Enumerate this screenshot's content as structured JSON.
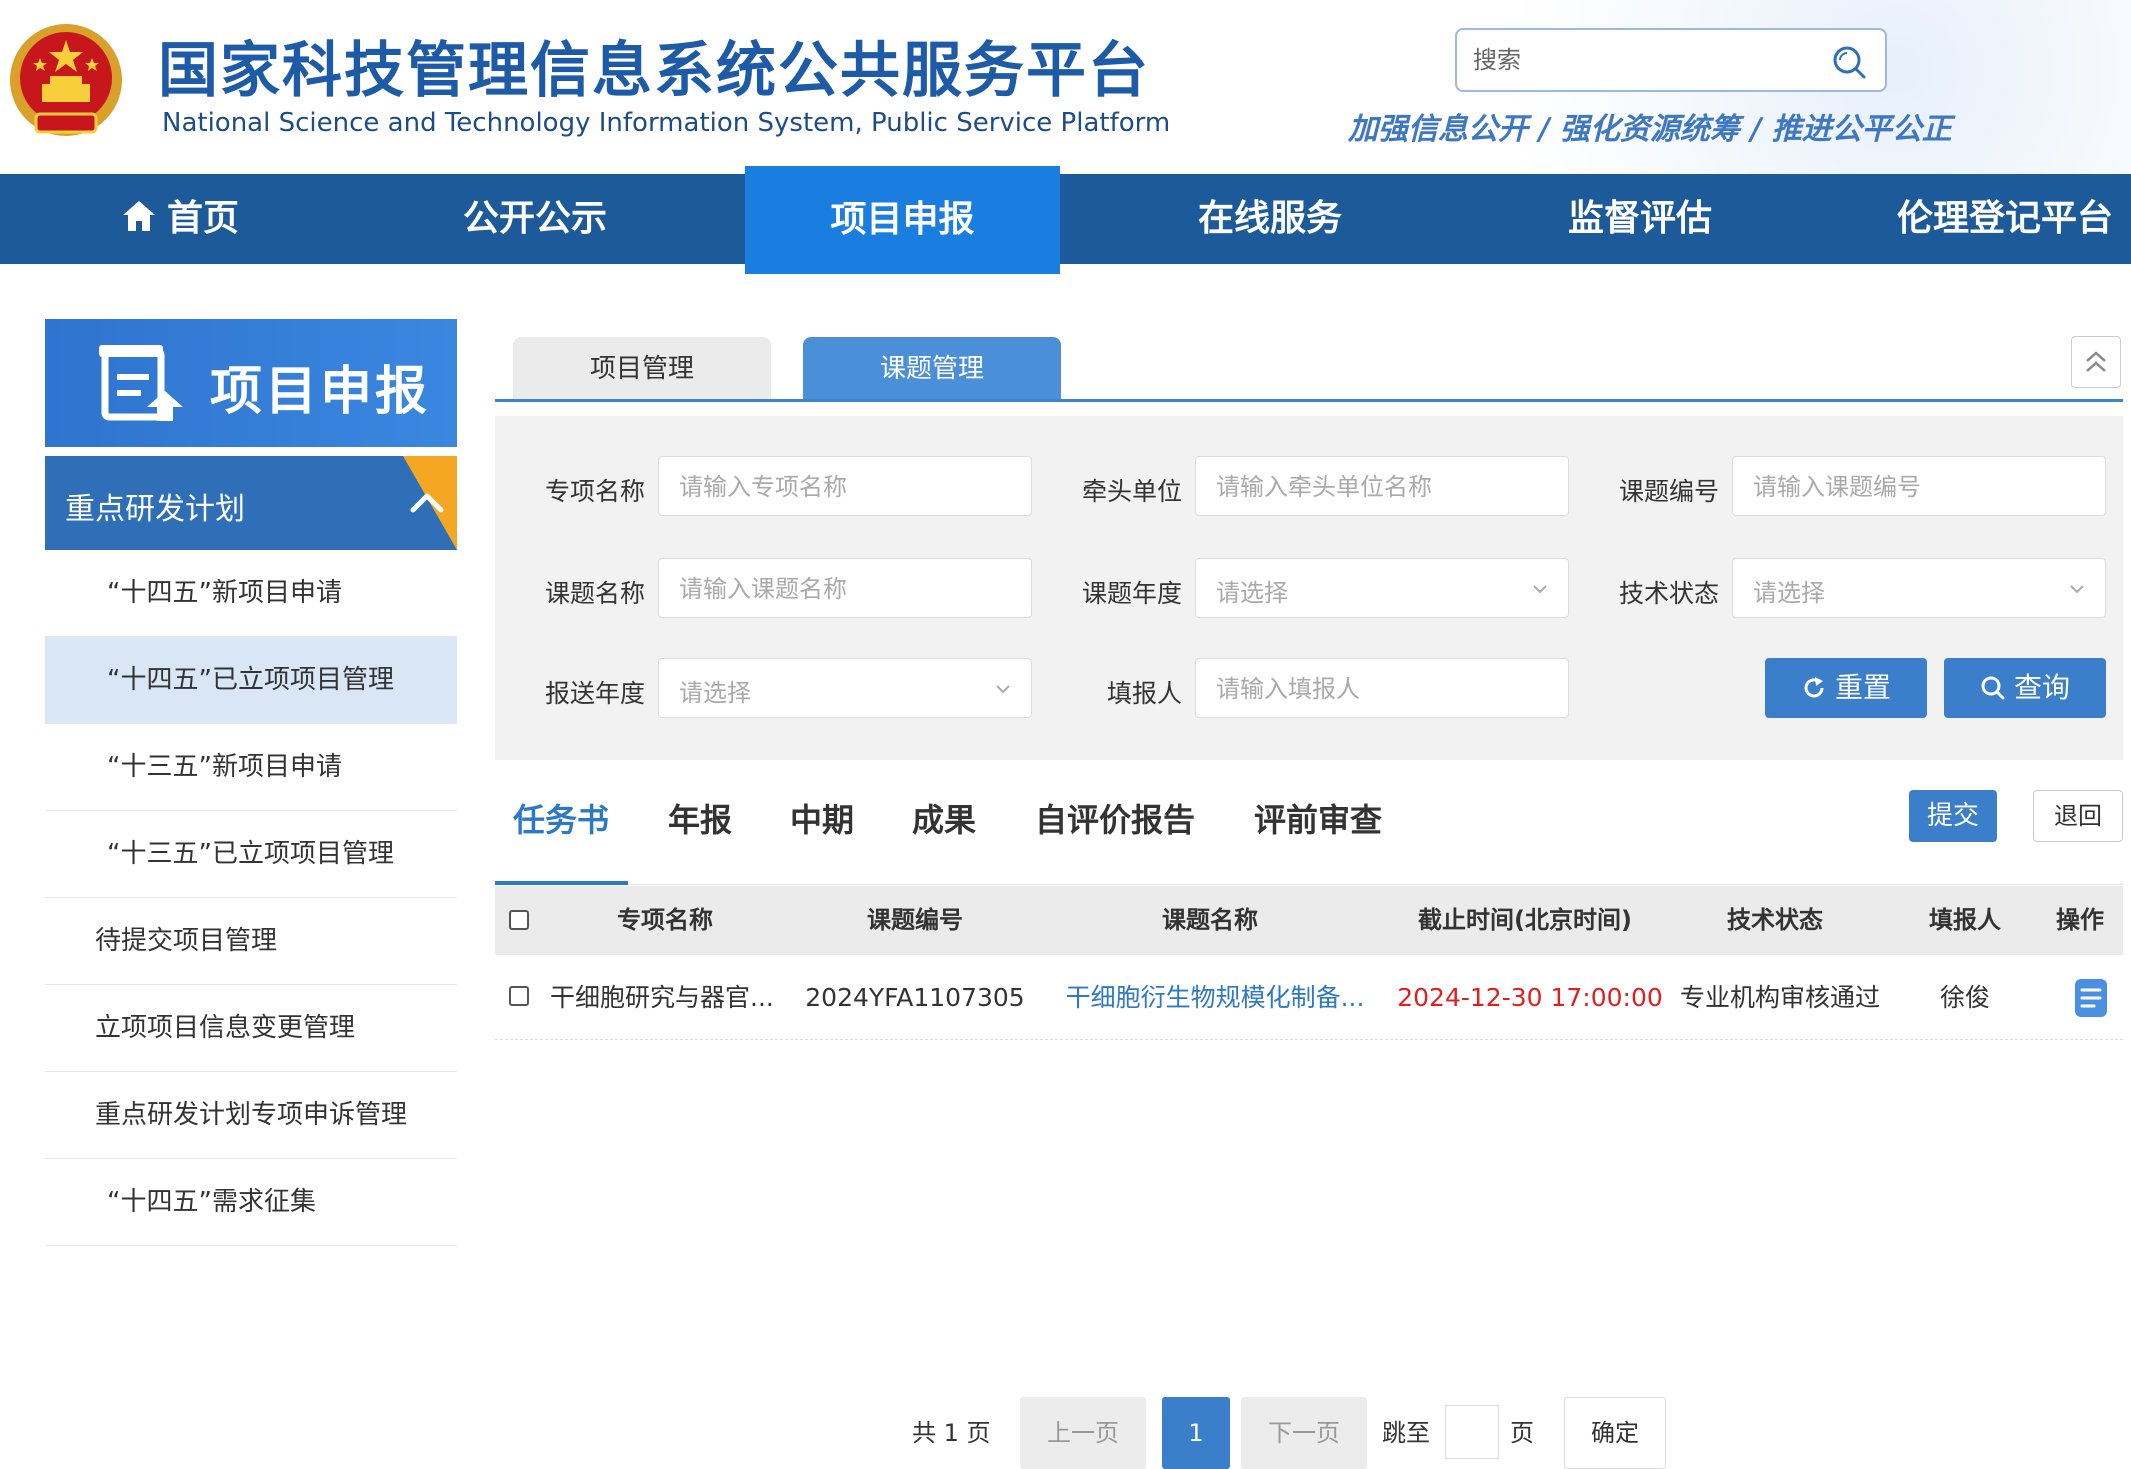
{
  "header": {
    "title_cn": "国家科技管理信息系统公共服务平台",
    "title_en": "National Science and Technology Information System, Public Service Platform",
    "search_placeholder": "搜索",
    "slogan": "加强信息公开 / 强化资源统筹 / 推进公平公正"
  },
  "nav": {
    "items": [
      {
        "label": "首页"
      },
      {
        "label": "公开公示"
      },
      {
        "label": "项目申报"
      },
      {
        "label": "在线服务"
      },
      {
        "label": "监督评估"
      },
      {
        "label": "伦理登记平台"
      }
    ],
    "active_index": 2
  },
  "sidebar": {
    "banner": "项目申报",
    "group": "重点研发计划",
    "items": [
      {
        "label": "“十四五”新项目申请"
      },
      {
        "label": "“十四五”已立项项目管理"
      },
      {
        "label": "“十三五”新项目申请"
      },
      {
        "label": "“十三五”已立项项目管理"
      },
      {
        "label": "待提交项目管理"
      },
      {
        "label": "立项项目信息变更管理"
      },
      {
        "label": "重点研发计划专项申诉管理"
      },
      {
        "label": "“十四五”需求征集"
      }
    ],
    "active_index": 1
  },
  "top_tabs": [
    {
      "label": "项目管理"
    },
    {
      "label": "课题管理"
    }
  ],
  "filters": {
    "special_name": {
      "label": "专项名称",
      "placeholder": "请输入专项名称"
    },
    "lead_unit": {
      "label": "牵头单位",
      "placeholder": "请输入牵头单位名称"
    },
    "topic_no": {
      "label": "课题编号",
      "placeholder": "请输入课题编号"
    },
    "topic_name": {
      "label": "课题名称",
      "placeholder": "请输入课题名称"
    },
    "topic_year": {
      "label": "课题年度",
      "placeholder": "请选择"
    },
    "tech_status": {
      "label": "技术状态",
      "placeholder": "请选择"
    },
    "report_year": {
      "label": "报送年度",
      "placeholder": "请选择"
    },
    "filler": {
      "label": "填报人",
      "placeholder": "请输入填报人"
    },
    "reset_label": "重置",
    "query_label": "查询"
  },
  "sub_tabs": [
    {
      "label": "任务书"
    },
    {
      "label": "年报"
    },
    {
      "label": "中期"
    },
    {
      "label": "成果"
    },
    {
      "label": "自评价报告"
    },
    {
      "label": "评前审查"
    }
  ],
  "actions": {
    "submit": "提交",
    "return": "退回"
  },
  "table": {
    "headers": [
      "专项名称",
      "课题编号",
      "课题名称",
      "截止时间(北京时间)",
      "技术状态",
      "填报人",
      "操作"
    ],
    "rows": [
      {
        "special_name": "干细胞研究与器官...",
        "topic_no": "2024YFA1107305",
        "topic_name": "干细胞衍生物规模化制备...",
        "deadline": "2024-12-30 17:00:00",
        "tech_status": "专业机构审核通过",
        "filler": "徐俊"
      }
    ]
  },
  "pager": {
    "total_text": "共 1 页",
    "prev": "上一页",
    "current": "1",
    "next": "下一页",
    "jump_to": "跳至",
    "page_unit": "页",
    "confirm": "确定"
  },
  "colors": {
    "nav_bg": "#1d5a9a",
    "nav_active": "#1a7ee0",
    "accent": "#3b7ec9",
    "deadline": "#e0201f",
    "sidebar_corner": "#f5a623"
  }
}
